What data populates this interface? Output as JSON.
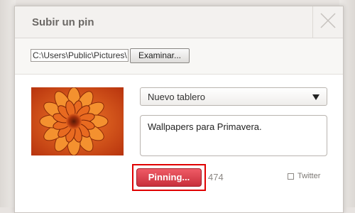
{
  "dialog": {
    "title": "Subir un pin"
  },
  "file": {
    "path_value": "C:\\Users\\Public\\Pictures\\",
    "browse_label": "Examinar..."
  },
  "board": {
    "selected": "Nuevo tablero"
  },
  "description": {
    "value": "Wallpapers para Primavera."
  },
  "actions": {
    "pin_label": "Pinning...",
    "char_count": "474",
    "twitter_label": "Twitter",
    "twitter_checked": false
  },
  "icons": {
    "close": "close-x-icon",
    "select_arrow": "triangle-down-icon",
    "thumbnail": "orange-flower-image"
  },
  "colors": {
    "pin_button": "#d8363f",
    "highlight_outline": "#e00000",
    "header_bg": "#f3f1ef"
  }
}
